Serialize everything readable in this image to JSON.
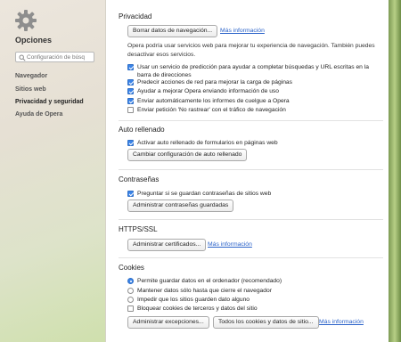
{
  "sidebar": {
    "title": "Opciones",
    "search_placeholder": "Configuración de búsq",
    "items": [
      {
        "label": "Navegador"
      },
      {
        "label": "Sitios web"
      },
      {
        "label": "Privacidad y seguridad"
      },
      {
        "label": "Ayuda de Opera"
      }
    ]
  },
  "privacy": {
    "title": "Privacidad",
    "clear_button": "Borrar datos de navegación...",
    "more_info": "Más información",
    "description": "Opera podría usar servicios web para mejorar tu experiencia de navegación. También puedes desactivar esos servicios.",
    "options": [
      {
        "label": "Usar un servicio de predicción para ayudar a completar búsquedas y URL escritas en la barra de direcciones",
        "checked": true
      },
      {
        "label": "Predecir acciones de red para mejorar la carga de páginas",
        "checked": true
      },
      {
        "label": "Ayudar a mejorar Opera enviando información de uso",
        "checked": true
      },
      {
        "label": "Enviar automáticamente los informes de cuelgue a Opera",
        "checked": true
      },
      {
        "label": "Enviar petición 'No rastrear' con el tráfico de navegación",
        "checked": false
      }
    ]
  },
  "autofill": {
    "title": "Auto rellenado",
    "option": "Activar auto rellenado de formularios en páginas web",
    "checked": true,
    "button": "Cambiar configuración de auto rellenado"
  },
  "passwords": {
    "title": "Contraseñas",
    "option": "Preguntar si se guardan contraseñas de sitios web",
    "checked": true,
    "button": "Administrar contraseñas guardadas"
  },
  "https": {
    "title": "HTTPS/SSL",
    "button": "Administrar certificados...",
    "more_info": "Más información"
  },
  "cookies": {
    "title": "Cookies",
    "radios": [
      {
        "label": "Permite guardar datos en el ordenador (recomendado)",
        "checked": true
      },
      {
        "label": "Mantener datos sólo hasta que cierre el navegador",
        "checked": false
      },
      {
        "label": "Impedir que los sitios guarden dato alguno",
        "checked": false
      }
    ],
    "block_third_party": {
      "label": "Bloquear cookies de terceros y datos del sitio",
      "checked": false
    },
    "exceptions_button": "Administrar excepciones...",
    "all_button": "Todos los cookies y datos de sitio...",
    "more_info": "Más información"
  },
  "colors": {
    "accent": "#3b84e8",
    "link": "#2a62c9"
  },
  "icons": {
    "app": "gear-icon",
    "search": "search-icon"
  }
}
